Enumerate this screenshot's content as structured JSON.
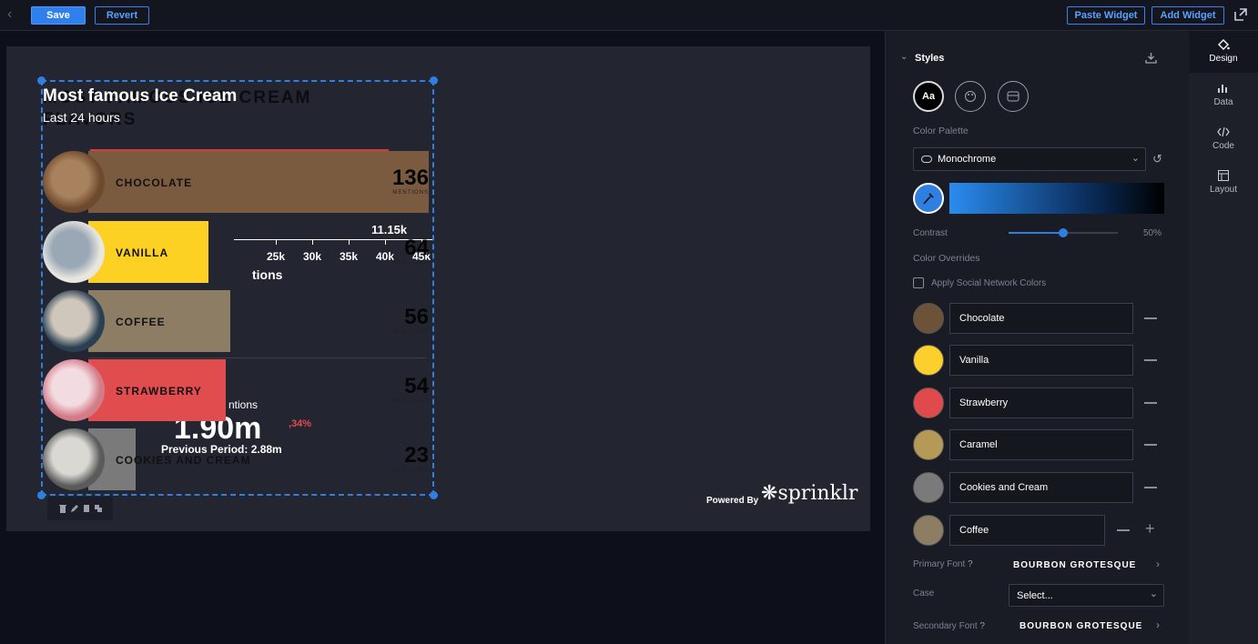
{
  "topbar": {
    "save_label": "Save",
    "revert_label": "Revert",
    "paste_label": "Paste Widget",
    "add_label": "Add Widget"
  },
  "widget": {
    "title_white": "Most famous Ice Cream",
    "title_ghost": "MOST FAMOUS ICE CREAM FLAVORS",
    "subtitle": "Last 24 hours",
    "stat_1": "11.15k",
    "axis_ticks": [
      "25k",
      "30k",
      "35k",
      "40k",
      "45k"
    ],
    "axis_label_partial": "tions",
    "mentions_label": "ntions",
    "big_value": "1.90m",
    "change": "34%",
    "previous": "Previous Period: 2.88m",
    "mentions_caption": "MENTIONS",
    "rows": [
      {
        "name": "CHOCOLATE",
        "value": "136",
        "color": "#7a5b3f"
      },
      {
        "name": "VANILLA",
        "value": "64",
        "color": "#fdd024"
      },
      {
        "name": "COFFEE",
        "value": "56",
        "color": "#8d7d64"
      },
      {
        "name": "STRAWBERRY",
        "value": "54",
        "color": "#e14d4f"
      },
      {
        "name": "COOKIES AND CREAM",
        "value": "23",
        "color": "#7a7a7a"
      }
    ]
  },
  "footer": {
    "powered_by": "Powered By",
    "brand": "sprinklr"
  },
  "panel": {
    "styles_title": "Styles",
    "font_badge": "Aa",
    "color_palette_label": "Color Palette",
    "palette_value": "Monochrome",
    "contrast_label": "Contrast",
    "contrast_value": "50%",
    "contrast_level": 0.5,
    "overrides_label": "Color Overrides",
    "social_label": "Apply Social Network Colors",
    "overrides": [
      {
        "name": "Chocolate",
        "color": "#6b5238"
      },
      {
        "name": "Vanilla",
        "color": "#fcd02c"
      },
      {
        "name": "Strawberry",
        "color": "#e14a4d"
      },
      {
        "name": "Caramel",
        "color": "#b59a57"
      },
      {
        "name": "Cookies and Cream",
        "color": "#7a7a7a"
      },
      {
        "name": "Coffee",
        "color": "#8c7d63"
      }
    ],
    "primary_font_label": "Primary Font",
    "primary_font_value": "BOURBON GROTESQUE",
    "case_label": "Case",
    "case_value": "Select...",
    "secondary_font_label": "Secondary Font",
    "secondary_font_value": "BOURBON GROTESQUE"
  },
  "sidenav": {
    "design": "Design",
    "data": "Data",
    "code": "Code",
    "layout": "Layout"
  }
}
